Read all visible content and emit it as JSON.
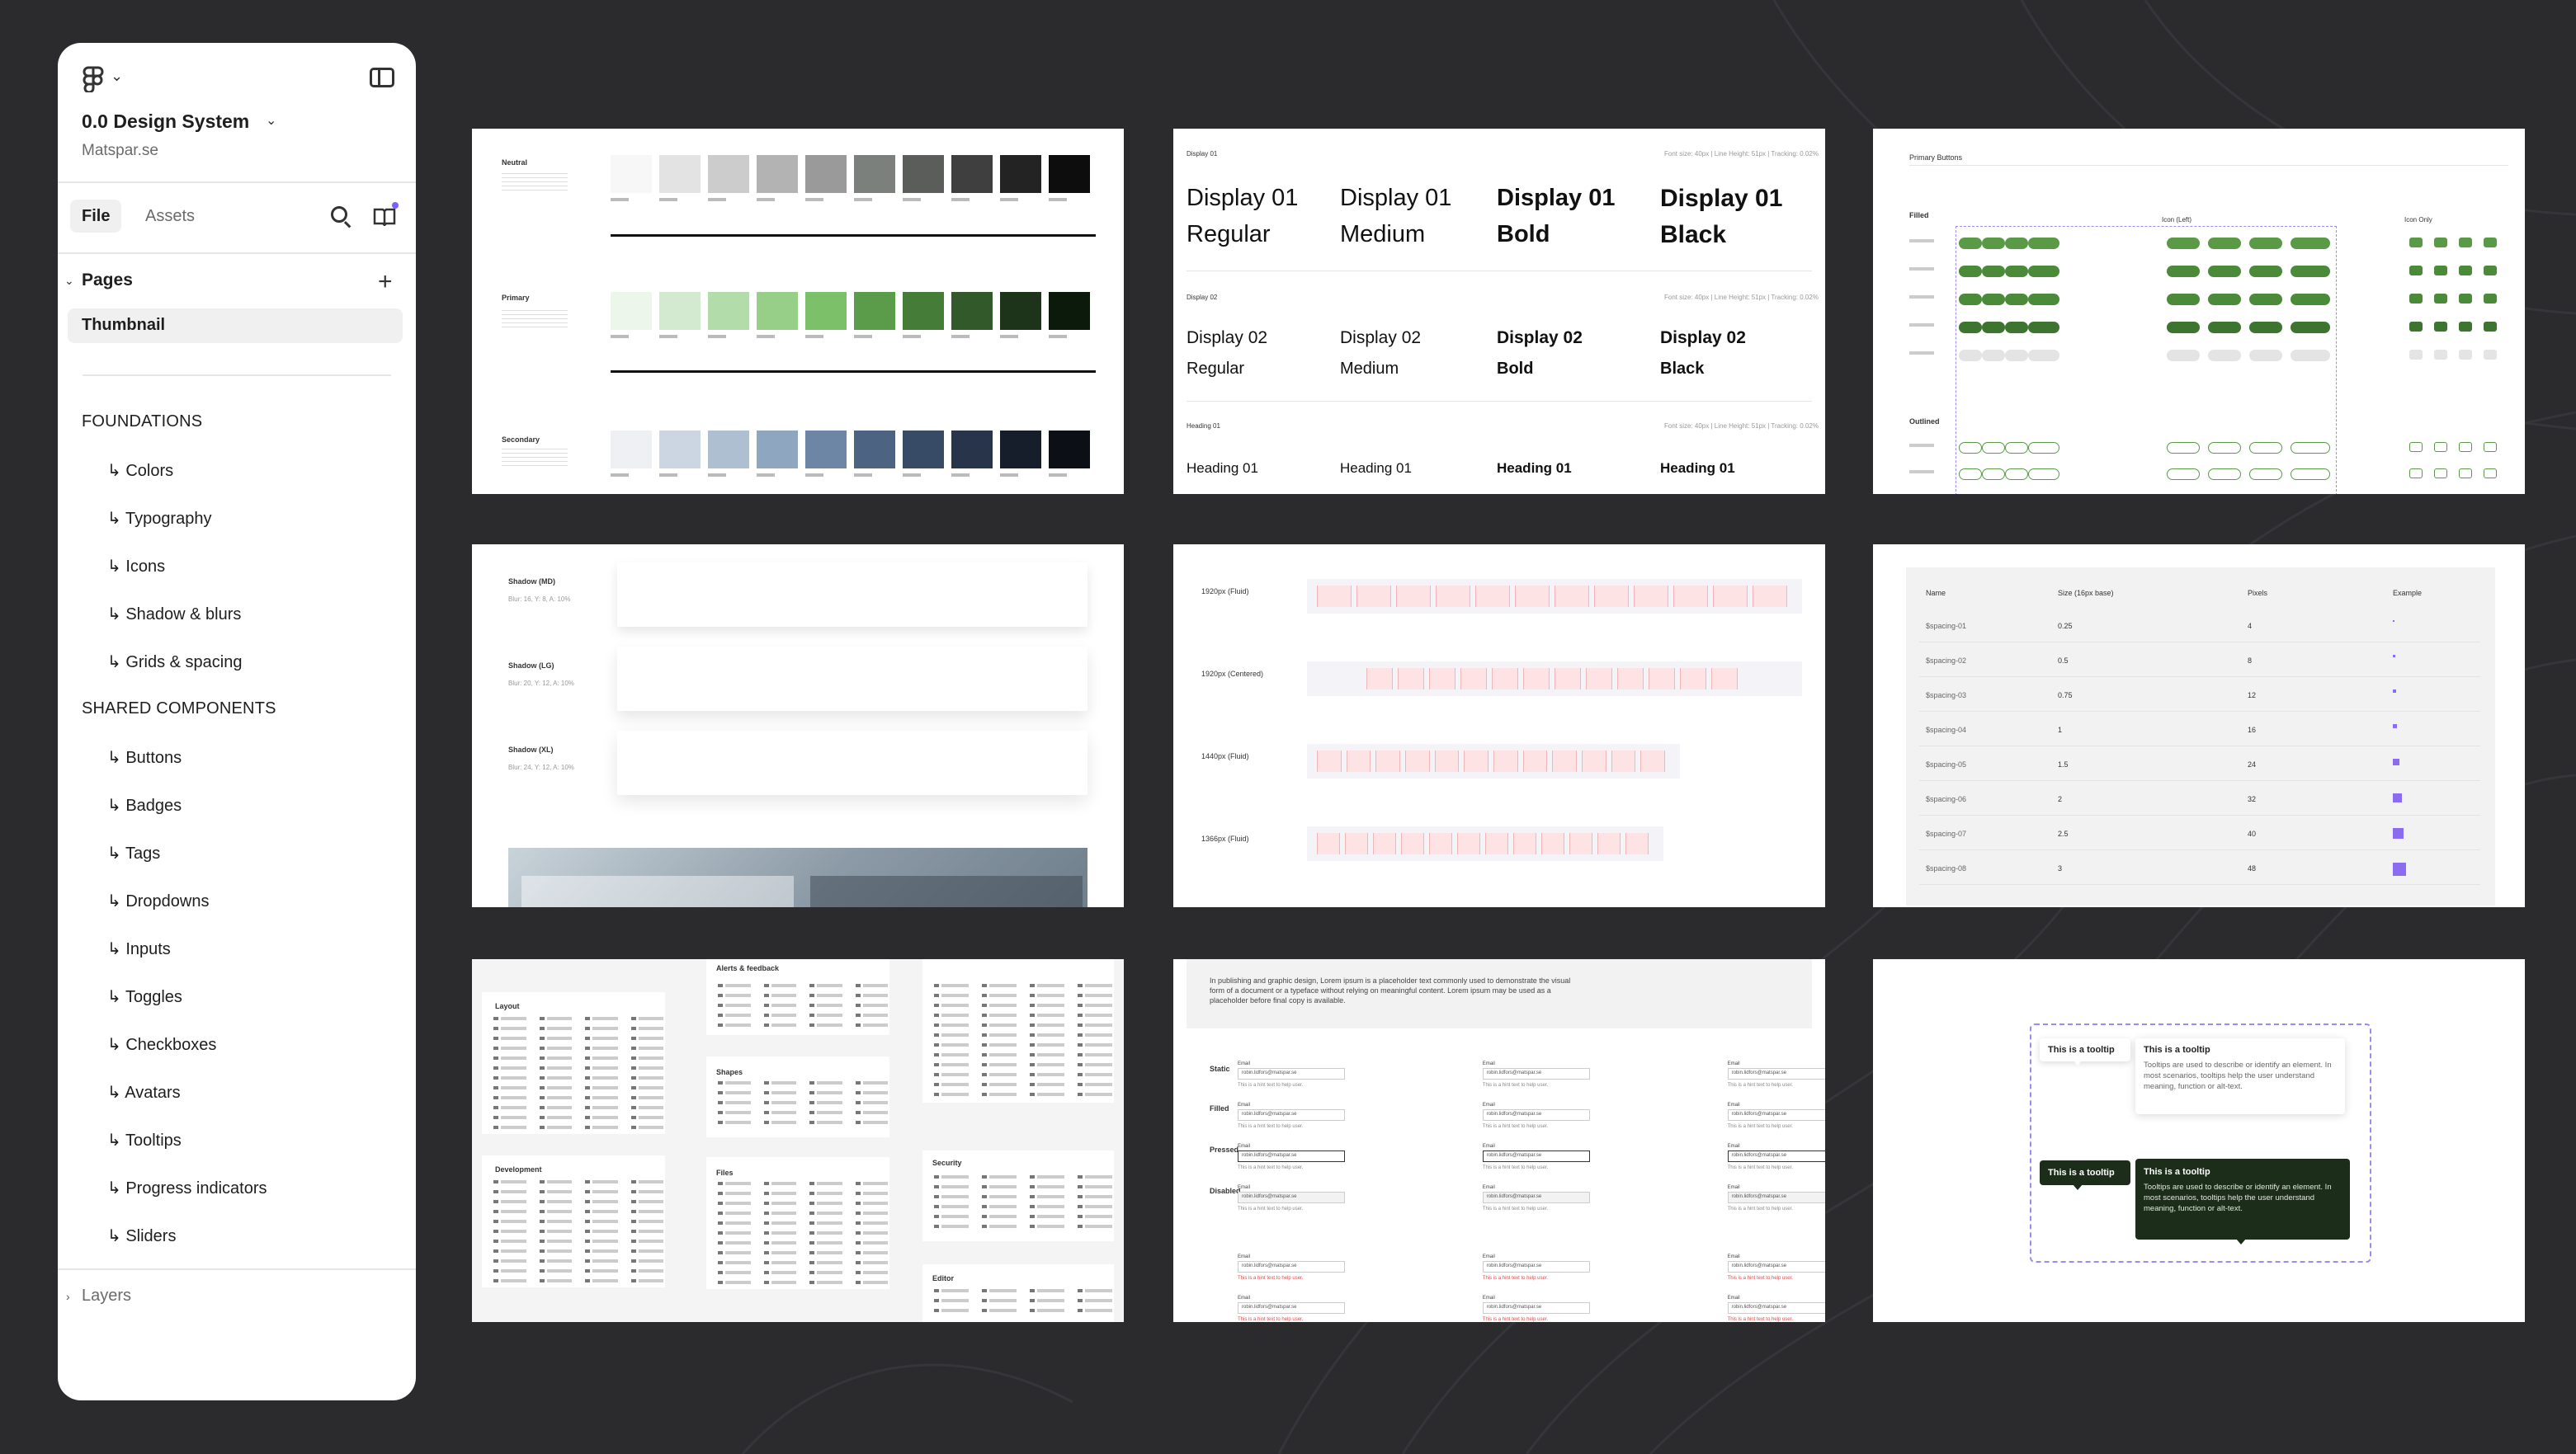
{
  "project": {
    "title": "0.0 Design System",
    "team": "Matspar.se"
  },
  "tabs": {
    "file": "File",
    "assets": "Assets"
  },
  "pages": {
    "label": "Pages",
    "items": [
      "Thumbnail"
    ]
  },
  "sections": [
    {
      "title": "FOUNDATIONS",
      "items": [
        "↳ Colors",
        "↳ Typography",
        "↳ Icons",
        "↳ Shadow & blurs",
        "↳ Grids & spacing"
      ]
    },
    {
      "title": "SHARED COMPONENTS",
      "items": [
        "↳ Buttons",
        "↳ Badges",
        "↳ Tags",
        "↳ Dropdowns",
        "↳ Inputs",
        "↳ Toggles",
        "↳ Checkboxes",
        "↳ Avatars",
        "↳ Tooltips",
        "↳ Progress indicators",
        "↳ Sliders"
      ]
    }
  ],
  "layers": {
    "label": "Layers"
  },
  "icons": {
    "logo": "figma-logo-icon",
    "panel": "sidebar-toggle-icon",
    "search": "search-icon",
    "library": "library-icon",
    "add": "plus-icon",
    "chevron": "chevron-down-icon"
  },
  "colors_card": {
    "groups": [
      {
        "name": "Neutral",
        "swatches": [
          "#f7f7f7",
          "#e3e3e3",
          "#cccccc",
          "#b3b3b3",
          "#9a9a9a",
          "#7c807c",
          "#5a5d5a",
          "#3e3f3e",
          "#222322",
          "#0c0d0c"
        ]
      },
      {
        "name": "Primary",
        "swatches": [
          "#edf6ea",
          "#d3ead0",
          "#b2dca9",
          "#97cf89",
          "#7cc06a",
          "#5b9c4b",
          "#457c38",
          "#31592a",
          "#1d341a",
          "#0c1a0b"
        ]
      },
      {
        "name": "Secondary",
        "swatches": [
          "#eef0f4",
          "#ccd6e2",
          "#aebfd2",
          "#8fa6c0",
          "#6e86a5",
          "#4c6382",
          "#374a66",
          "#27344a",
          "#171e2b",
          "#0c0f16"
        ]
      }
    ]
  },
  "typography_card": {
    "display01_label": "Display 01",
    "display02_label": "Display 02",
    "heading01_label": "Heading 01",
    "specs": "Font size: 40px | Line Height: 51px | Tracking: 0.02%",
    "display01": [
      "Display 01",
      "Display 01",
      "Display 01",
      "Display 01"
    ],
    "display02": [
      "Display 02",
      "Display 02",
      "Display 02",
      "Display 02"
    ],
    "heading01": [
      "Heading 01",
      "Heading 01",
      "Heading 01",
      "Heading 01"
    ],
    "weights": [
      "Regular",
      "Medium",
      "Bold",
      "Black"
    ]
  },
  "buttons_card": {
    "title": "Primary Buttons",
    "filled": "Filled",
    "outlined": "Outlined",
    "icon_left": "Icon (Left)",
    "icon_only": "Icon Only",
    "states": [
      "Enabled",
      "Hovered",
      "Focused",
      "Pressed",
      "Disabled"
    ],
    "outlined_states": [
      "Enabled",
      "Hovered"
    ],
    "button_label": "Button"
  },
  "shadow_card": {
    "items": [
      {
        "name": "Shadow (MD)",
        "spec": "Blur: 16, Y: 8, A: 10%"
      },
      {
        "name": "Shadow (LG)",
        "spec": "Blur: 20, Y: 12, A: 10%"
      },
      {
        "name": "Shadow (XL)",
        "spec": "Blur: 24, Y: 12, A: 10%"
      }
    ]
  },
  "grids_card": {
    "rows": [
      "1920px (Fluid)",
      "1920px (Centered)",
      "1440px (Fluid)",
      "1366px (Fluid)"
    ]
  },
  "spacing_card": {
    "headers": [
      "Name",
      "Size (16px base)",
      "Pixels",
      "Example"
    ],
    "rows": [
      [
        "$spacing-01",
        "0.25",
        "4"
      ],
      [
        "$spacing-02",
        "0.5",
        "8"
      ],
      [
        "$spacing-03",
        "0.75",
        "12"
      ],
      [
        "$spacing-04",
        "1",
        "16"
      ],
      [
        "$spacing-05",
        "1.5",
        "24"
      ],
      [
        "$spacing-06",
        "2",
        "32"
      ],
      [
        "$spacing-07",
        "2.5",
        "40"
      ],
      [
        "$spacing-08",
        "3",
        "48"
      ]
    ]
  },
  "icons_card": {
    "groups": [
      "Layout",
      "Alerts & feedback",
      "Shapes",
      "Development",
      "Files",
      "Security",
      "Editor"
    ]
  },
  "inputs_card": {
    "intro": "In publishing and graphic design, Lorem ipsum is a placeholder text commonly used to demonstrate the visual form of a document or a typeface without relying on meaningful content. Lorem ipsum may be used as a placeholder before final copy is available.",
    "states": [
      "Static",
      "Filled",
      "Pressed",
      "Disabled"
    ],
    "field_label": "Email",
    "field_value": "robin.lidfors@matspar.se",
    "hint": "This is a hint text to help user."
  },
  "tooltips_card": {
    "short": "This is a tooltip",
    "title": "This is a tooltip",
    "body": "Tooltips are used to describe or identify an element. In most scenarios, tooltips help the user understand meaning, function or alt-text."
  }
}
